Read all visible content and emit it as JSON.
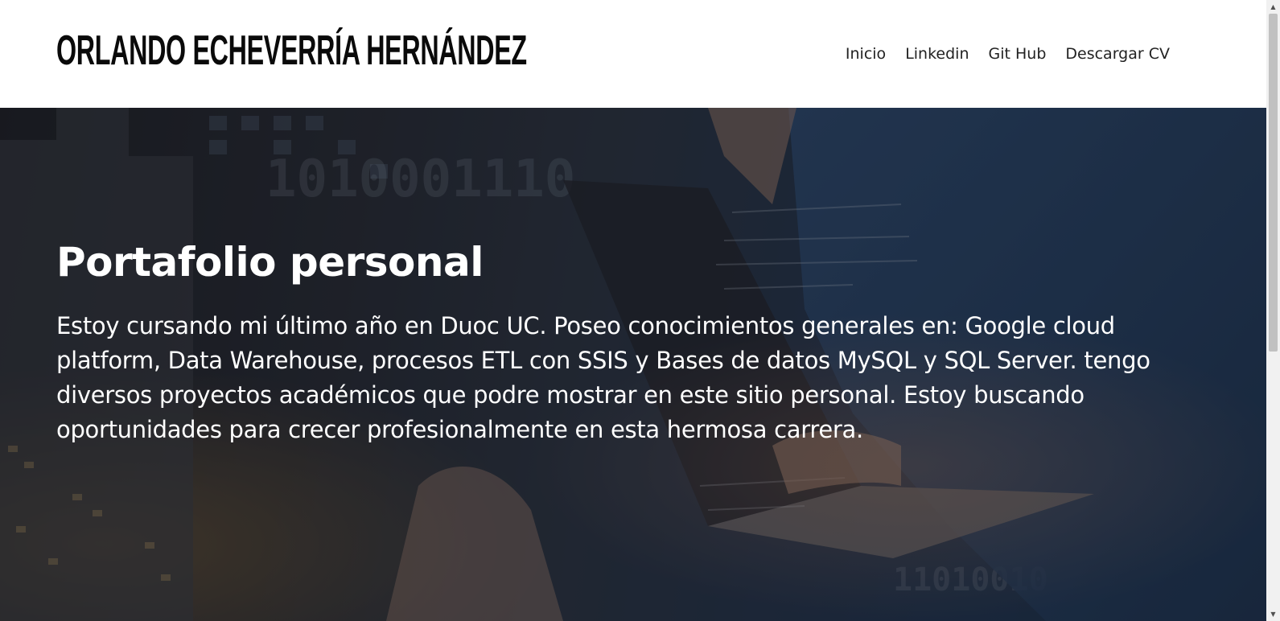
{
  "header": {
    "site_title": "Orlando Echeverría Hernández",
    "nav": [
      {
        "label": "Inicio"
      },
      {
        "label": "Linkedin"
      },
      {
        "label": "Git Hub"
      },
      {
        "label": "Descargar CV"
      }
    ]
  },
  "hero": {
    "title": "Portafolio personal",
    "description": "Estoy cursando mi último año en Duoc UC. Poseo conocimientos generales en: Google cloud platform, Data Warehouse, procesos ETL con SSIS y Bases de datos MySQL y SQL Server. tengo diversos proyectos académicos que podre mostrar en este sitio personal. Estoy buscando oportunidades para crecer profesionalmente en esta hermosa carrera."
  },
  "scrollbar": {
    "up_icon": "scroll-up-arrow-icon",
    "down_icon": "scroll-down-arrow-icon"
  },
  "colors": {
    "header_bg": "#ffffff",
    "title_text": "#0a0a0a",
    "nav_text": "#222222",
    "hero_text": "#ffffff"
  }
}
